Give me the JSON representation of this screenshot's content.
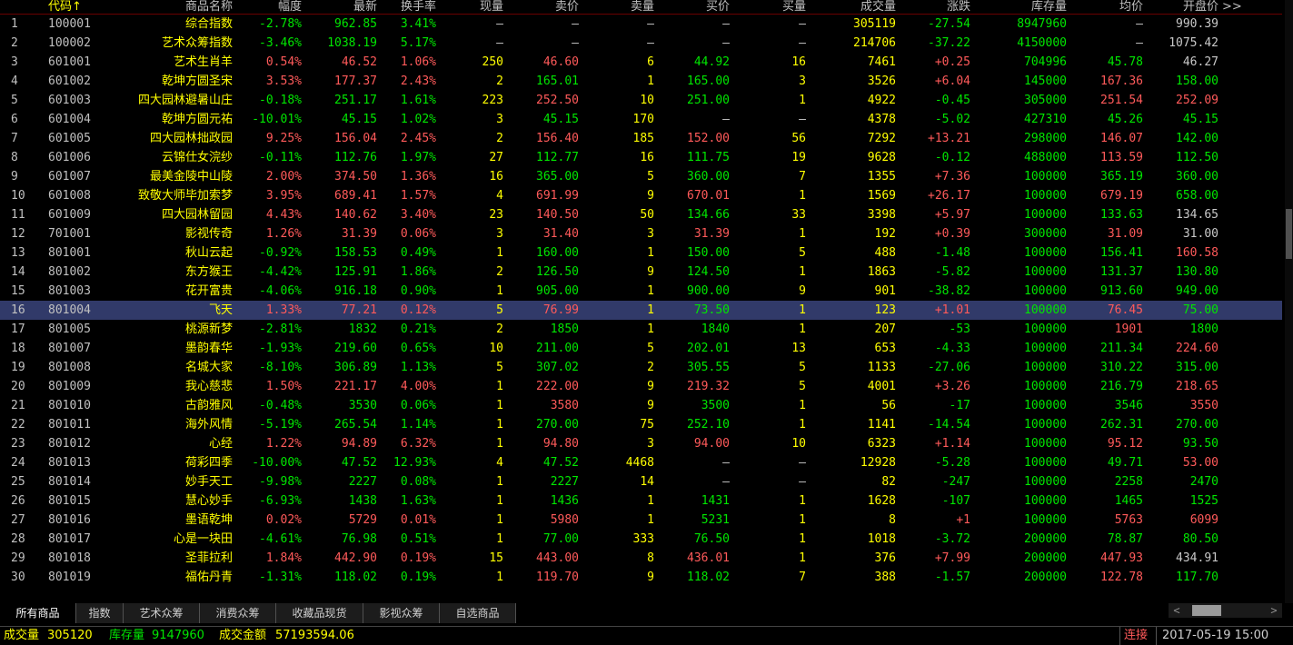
{
  "colors": {
    "up": "#ff5a5a",
    "down": "#00e600",
    "flat": "#c8c8c8",
    "name": "#ffff00",
    "code": "#c0c0c0",
    "volume": "#ffff00",
    "stock": "#00e600",
    "header_sort": "#ffff00",
    "connect": "#ff5a5a"
  },
  "header": {
    "more": ">>",
    "columns": [
      {
        "label": "代码↑"
      },
      {
        "label": "商品名称"
      },
      {
        "label": "幅度"
      },
      {
        "label": "最新"
      },
      {
        "label": "换手率"
      },
      {
        "label": "现量"
      },
      {
        "label": "卖价"
      },
      {
        "label": "卖量"
      },
      {
        "label": "买价"
      },
      {
        "label": "买量"
      },
      {
        "label": "成交量"
      },
      {
        "label": "涨跌"
      },
      {
        "label": "库存量"
      },
      {
        "label": "均价"
      },
      {
        "label": "开盘价"
      }
    ]
  },
  "rows": [
    {
      "n": "1",
      "code": "100001",
      "name": "综合指数",
      "pct": "-2.78%",
      "last": "962.85",
      "turn": "3.41%",
      "cur": "—",
      "ask": "—",
      "askv": "—",
      "bid": "—",
      "bidv": "—",
      "vol": "305119",
      "chg": "-27.54",
      "stock": "8947960",
      "avg": "—",
      "open": "990.39",
      "dir": "down",
      "oc": "flat"
    },
    {
      "n": "2",
      "code": "100002",
      "name": "艺术众筹指数",
      "pct": "-3.46%",
      "last": "1038.19",
      "turn": "5.17%",
      "cur": "—",
      "ask": "—",
      "askv": "—",
      "bid": "—",
      "bidv": "—",
      "vol": "214706",
      "chg": "-37.22",
      "stock": "4150000",
      "avg": "—",
      "open": "1075.42",
      "dir": "down",
      "oc": "flat"
    },
    {
      "n": "3",
      "code": "601001",
      "name": "艺术生肖羊",
      "pct": "0.54%",
      "last": "46.52",
      "turn": "1.06%",
      "cur": "250",
      "ask": "46.60",
      "askv": "6",
      "bid": "44.92",
      "bidv": "16",
      "vol": "7461",
      "chg": "+0.25",
      "stock": "704996",
      "avg": "45.78",
      "open": "46.27",
      "dir": "up",
      "ac": "up",
      "bc": "down",
      "avc": "down",
      "oc": "flat"
    },
    {
      "n": "4",
      "code": "601002",
      "name": "乾坤方圆圣宋",
      "pct": "3.53%",
      "last": "177.37",
      "turn": "2.43%",
      "cur": "2",
      "ask": "165.01",
      "askv": "1",
      "bid": "165.00",
      "bidv": "3",
      "vol": "3526",
      "chg": "+6.04",
      "stock": "145000",
      "avg": "167.36",
      "open": "158.00",
      "dir": "up",
      "ac": "down",
      "bc": "down",
      "avc": "up",
      "oc": "down"
    },
    {
      "n": "5",
      "code": "601003",
      "name": "四大园林避暑山庄",
      "pct": "-0.18%",
      "last": "251.17",
      "turn": "1.61%",
      "cur": "223",
      "ask": "252.50",
      "askv": "10",
      "bid": "251.00",
      "bidv": "1",
      "vol": "4922",
      "chg": "-0.45",
      "stock": "305000",
      "avg": "251.54",
      "open": "252.09",
      "dir": "down",
      "ac": "up",
      "bc": "down",
      "avc": "up",
      "oc": "up"
    },
    {
      "n": "6",
      "code": "601004",
      "name": "乾坤方圆元祐",
      "pct": "-10.01%",
      "last": "45.15",
      "turn": "1.02%",
      "cur": "3",
      "ask": "45.15",
      "askv": "170",
      "bid": "—",
      "bidv": "—",
      "vol": "4378",
      "chg": "-5.02",
      "stock": "427310",
      "avg": "45.26",
      "open": "45.15",
      "dir": "down",
      "ac": "down",
      "bc": "flat",
      "avc": "down",
      "oc": "down"
    },
    {
      "n": "7",
      "code": "601005",
      "name": "四大园林拙政园",
      "pct": "9.25%",
      "last": "156.04",
      "turn": "2.45%",
      "cur": "2",
      "ask": "156.40",
      "askv": "185",
      "bid": "152.00",
      "bidv": "56",
      "vol": "7292",
      "chg": "+13.21",
      "stock": "298000",
      "avg": "146.07",
      "open": "142.00",
      "dir": "up",
      "ac": "up",
      "bc": "up",
      "avc": "up",
      "oc": "down"
    },
    {
      "n": "8",
      "code": "601006",
      "name": "云锦仕女浣纱",
      "pct": "-0.11%",
      "last": "112.76",
      "turn": "1.97%",
      "cur": "27",
      "ask": "112.77",
      "askv": "16",
      "bid": "111.75",
      "bidv": "19",
      "vol": "9628",
      "chg": "-0.12",
      "stock": "488000",
      "avg": "113.59",
      "open": "112.50",
      "dir": "down",
      "ac": "down",
      "bc": "down",
      "avc": "up",
      "oc": "down"
    },
    {
      "n": "9",
      "code": "601007",
      "name": "最美金陵中山陵",
      "pct": "2.00%",
      "last": "374.50",
      "turn": "1.36%",
      "cur": "16",
      "ask": "365.00",
      "askv": "5",
      "bid": "360.00",
      "bidv": "7",
      "vol": "1355",
      "chg": "+7.36",
      "stock": "100000",
      "avg": "365.19",
      "open": "360.00",
      "dir": "up",
      "ac": "down",
      "bc": "down",
      "avc": "down",
      "oc": "down"
    },
    {
      "n": "10",
      "code": "601008",
      "name": "致敬大师毕加索梦",
      "pct": "3.95%",
      "last": "689.41",
      "turn": "1.57%",
      "cur": "4",
      "ask": "691.99",
      "askv": "9",
      "bid": "670.01",
      "bidv": "1",
      "vol": "1569",
      "chg": "+26.17",
      "stock": "100000",
      "avg": "679.19",
      "open": "658.00",
      "dir": "up",
      "ac": "up",
      "bc": "up",
      "avc": "up",
      "oc": "down"
    },
    {
      "n": "11",
      "code": "601009",
      "name": "四大园林留园",
      "pct": "4.43%",
      "last": "140.62",
      "turn": "3.40%",
      "cur": "23",
      "ask": "140.50",
      "askv": "50",
      "bid": "134.66",
      "bidv": "33",
      "vol": "3398",
      "chg": "+5.97",
      "stock": "100000",
      "avg": "133.63",
      "open": "134.65",
      "dir": "up",
      "ac": "up",
      "bc": "down",
      "avc": "down",
      "oc": "flat"
    },
    {
      "n": "12",
      "code": "701001",
      "name": "影视传奇",
      "pct": "1.26%",
      "last": "31.39",
      "turn": "0.06%",
      "cur": "3",
      "ask": "31.40",
      "askv": "3",
      "bid": "31.39",
      "bidv": "1",
      "vol": "192",
      "chg": "+0.39",
      "stock": "300000",
      "avg": "31.09",
      "open": "31.00",
      "dir": "up",
      "ac": "up",
      "bc": "up",
      "avc": "up",
      "oc": "flat"
    },
    {
      "n": "13",
      "code": "801001",
      "name": "秋山云起",
      "pct": "-0.92%",
      "last": "158.53",
      "turn": "0.49%",
      "cur": "1",
      "ask": "160.00",
      "askv": "1",
      "bid": "150.00",
      "bidv": "5",
      "vol": "488",
      "chg": "-1.48",
      "stock": "100000",
      "avg": "156.41",
      "open": "160.58",
      "dir": "down",
      "ac": "down",
      "bc": "down",
      "avc": "down",
      "oc": "up"
    },
    {
      "n": "14",
      "code": "801002",
      "name": "东方猴王",
      "pct": "-4.42%",
      "last": "125.91",
      "turn": "1.86%",
      "cur": "2",
      "ask": "126.50",
      "askv": "9",
      "bid": "124.50",
      "bidv": "1",
      "vol": "1863",
      "chg": "-5.82",
      "stock": "100000",
      "avg": "131.37",
      "open": "130.80",
      "dir": "down",
      "ac": "down",
      "bc": "down",
      "avc": "down",
      "oc": "down"
    },
    {
      "n": "15",
      "code": "801003",
      "name": "花开富贵",
      "pct": "-4.06%",
      "last": "916.18",
      "turn": "0.90%",
      "cur": "1",
      "ask": "905.00",
      "askv": "1",
      "bid": "900.00",
      "bidv": "9",
      "vol": "901",
      "chg": "-38.82",
      "stock": "100000",
      "avg": "913.60",
      "open": "949.00",
      "dir": "down",
      "ac": "down",
      "bc": "down",
      "avc": "down",
      "oc": "down"
    },
    {
      "n": "16",
      "code": "801004",
      "name": "飞天",
      "pct": "1.33%",
      "last": "77.21",
      "turn": "0.12%",
      "cur": "5",
      "ask": "76.99",
      "askv": "1",
      "bid": "73.50",
      "bidv": "1",
      "vol": "123",
      "chg": "+1.01",
      "stock": "100000",
      "avg": "76.45",
      "open": "75.00",
      "dir": "up",
      "ac": "up",
      "bc": "down",
      "avc": "up",
      "oc": "down",
      "selected": true
    },
    {
      "n": "17",
      "code": "801005",
      "name": "桃源新梦",
      "pct": "-2.81%",
      "last": "1832",
      "turn": "0.21%",
      "cur": "2",
      "ask": "1850",
      "askv": "1",
      "bid": "1840",
      "bidv": "1",
      "vol": "207",
      "chg": "-53",
      "stock": "100000",
      "avg": "1901",
      "open": "1800",
      "dir": "down",
      "ac": "down",
      "bc": "down",
      "avc": "up",
      "oc": "down"
    },
    {
      "n": "18",
      "code": "801007",
      "name": "墨韵春华",
      "pct": "-1.93%",
      "last": "219.60",
      "turn": "0.65%",
      "cur": "10",
      "ask": "211.00",
      "askv": "5",
      "bid": "202.01",
      "bidv": "13",
      "vol": "653",
      "chg": "-4.33",
      "stock": "100000",
      "avg": "211.34",
      "open": "224.60",
      "dir": "down",
      "ac": "down",
      "bc": "down",
      "avc": "down",
      "oc": "up"
    },
    {
      "n": "19",
      "code": "801008",
      "name": "名城大家",
      "pct": "-8.10%",
      "last": "306.89",
      "turn": "1.13%",
      "cur": "5",
      "ask": "307.02",
      "askv": "2",
      "bid": "305.55",
      "bidv": "5",
      "vol": "1133",
      "chg": "-27.06",
      "stock": "100000",
      "avg": "310.22",
      "open": "315.00",
      "dir": "down",
      "ac": "down",
      "bc": "down",
      "avc": "down",
      "oc": "down"
    },
    {
      "n": "20",
      "code": "801009",
      "name": "我心慈悲",
      "pct": "1.50%",
      "last": "221.17",
      "turn": "4.00%",
      "cur": "1",
      "ask": "222.00",
      "askv": "9",
      "bid": "219.32",
      "bidv": "5",
      "vol": "4001",
      "chg": "+3.26",
      "stock": "100000",
      "avg": "216.79",
      "open": "218.65",
      "dir": "up",
      "ac": "up",
      "bc": "up",
      "avc": "down",
      "oc": "up"
    },
    {
      "n": "21",
      "code": "801010",
      "name": "古韵雅风",
      "pct": "-0.48%",
      "last": "3530",
      "turn": "0.06%",
      "cur": "1",
      "ask": "3580",
      "askv": "9",
      "bid": "3500",
      "bidv": "1",
      "vol": "56",
      "chg": "-17",
      "stock": "100000",
      "avg": "3546",
      "open": "3550",
      "dir": "down",
      "ac": "up",
      "bc": "down",
      "avc": "down",
      "oc": "up"
    },
    {
      "n": "22",
      "code": "801011",
      "name": "海外风情",
      "pct": "-5.19%",
      "last": "265.54",
      "turn": "1.14%",
      "cur": "1",
      "ask": "270.00",
      "askv": "75",
      "bid": "252.10",
      "bidv": "1",
      "vol": "1141",
      "chg": "-14.54",
      "stock": "100000",
      "avg": "262.31",
      "open": "270.00",
      "dir": "down",
      "ac": "down",
      "bc": "down",
      "avc": "down",
      "oc": "down"
    },
    {
      "n": "23",
      "code": "801012",
      "name": "心经",
      "pct": "1.22%",
      "last": "94.89",
      "turn": "6.32%",
      "cur": "1",
      "ask": "94.80",
      "askv": "3",
      "bid": "94.00",
      "bidv": "10",
      "vol": "6323",
      "chg": "+1.14",
      "stock": "100000",
      "avg": "95.12",
      "open": "93.50",
      "dir": "up",
      "ac": "up",
      "bc": "up",
      "avc": "up",
      "oc": "down"
    },
    {
      "n": "24",
      "code": "801013",
      "name": "荷彩四季",
      "pct": "-10.00%",
      "last": "47.52",
      "turn": "12.93%",
      "cur": "4",
      "ask": "47.52",
      "askv": "4468",
      "bid": "—",
      "bidv": "—",
      "vol": "12928",
      "chg": "-5.28",
      "stock": "100000",
      "avg": "49.71",
      "open": "53.00",
      "dir": "down",
      "ac": "down",
      "bc": "flat",
      "avc": "down",
      "oc": "up"
    },
    {
      "n": "25",
      "code": "801014",
      "name": "妙手天工",
      "pct": "-9.98%",
      "last": "2227",
      "turn": "0.08%",
      "cur": "1",
      "ask": "2227",
      "askv": "14",
      "bid": "—",
      "bidv": "—",
      "vol": "82",
      "chg": "-247",
      "stock": "100000",
      "avg": "2258",
      "open": "2470",
      "dir": "down",
      "ac": "down",
      "bc": "flat",
      "avc": "down",
      "oc": "down"
    },
    {
      "n": "26",
      "code": "801015",
      "name": "慧心妙手",
      "pct": "-6.93%",
      "last": "1438",
      "turn": "1.63%",
      "cur": "1",
      "ask": "1436",
      "askv": "1",
      "bid": "1431",
      "bidv": "1",
      "vol": "1628",
      "chg": "-107",
      "stock": "100000",
      "avg": "1465",
      "open": "1525",
      "dir": "down",
      "ac": "down",
      "bc": "down",
      "avc": "down",
      "oc": "down"
    },
    {
      "n": "27",
      "code": "801016",
      "name": "墨语乾坤",
      "pct": "0.02%",
      "last": "5729",
      "turn": "0.01%",
      "cur": "1",
      "ask": "5980",
      "askv": "1",
      "bid": "5231",
      "bidv": "1",
      "vol": "8",
      "chg": "+1",
      "stock": "100000",
      "avg": "5763",
      "open": "6099",
      "dir": "up",
      "ac": "up",
      "bc": "down",
      "avc": "up",
      "oc": "up"
    },
    {
      "n": "28",
      "code": "801017",
      "name": "心是一块田",
      "pct": "-4.61%",
      "last": "76.98",
      "turn": "0.51%",
      "cur": "1",
      "ask": "77.00",
      "askv": "333",
      "bid": "76.50",
      "bidv": "1",
      "vol": "1018",
      "chg": "-3.72",
      "stock": "200000",
      "avg": "78.87",
      "open": "80.50",
      "dir": "down",
      "ac": "down",
      "bc": "down",
      "avc": "down",
      "oc": "down"
    },
    {
      "n": "29",
      "code": "801018",
      "name": "圣菲拉利",
      "pct": "1.84%",
      "last": "442.90",
      "turn": "0.19%",
      "cur": "15",
      "ask": "443.00",
      "askv": "8",
      "bid": "436.01",
      "bidv": "1",
      "vol": "376",
      "chg": "+7.99",
      "stock": "200000",
      "avg": "447.93",
      "open": "434.91",
      "dir": "up",
      "ac": "up",
      "bc": "up",
      "avc": "up",
      "oc": "flat"
    },
    {
      "n": "30",
      "code": "801019",
      "name": "福佑丹青",
      "pct": "-1.31%",
      "last": "118.02",
      "turn": "0.19%",
      "cur": "1",
      "ask": "119.70",
      "askv": "9",
      "bid": "118.02",
      "bidv": "7",
      "vol": "388",
      "chg": "-1.57",
      "stock": "200000",
      "avg": "122.78",
      "open": "117.70",
      "dir": "down",
      "ac": "up",
      "bc": "down",
      "avc": "up",
      "oc": "down"
    }
  ],
  "tabs": [
    "所有商品",
    "指数",
    "艺术众筹",
    "消费众筹",
    "收藏品现货",
    "影视众筹",
    "自选商品"
  ],
  "status": {
    "volume_label": "成交量",
    "volume": "305120",
    "stock_label": "库存量",
    "stock": "9147960",
    "amount_label": "成交金额",
    "amount": "57193594.06",
    "connect": "连接",
    "datetime": "2017-05-19 15:00"
  }
}
